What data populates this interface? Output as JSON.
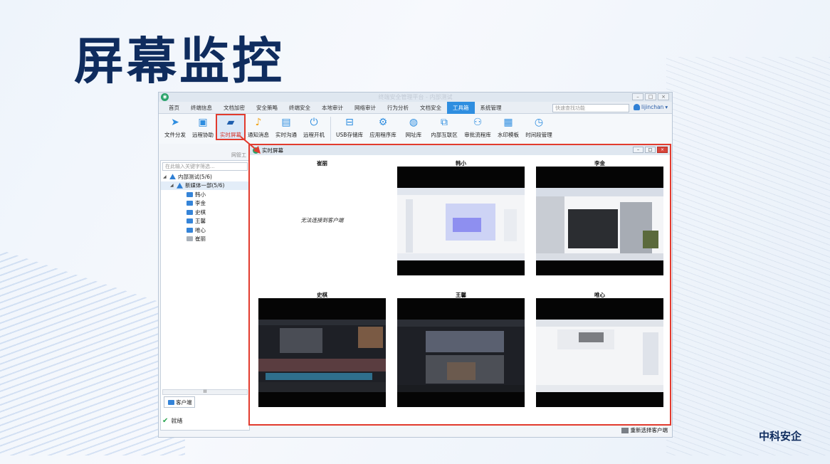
{
  "slide": {
    "title": "屏幕监控",
    "brand": "中科安企"
  },
  "app": {
    "window_title": "终端安全管理平台 - 内部测试",
    "menu": [
      "首页",
      "终端信息",
      "文档加密",
      "安全策略",
      "终端安全",
      "本地审计",
      "网络审计",
      "行为分析",
      "文档安全",
      "工具箱",
      "系统管理"
    ],
    "active_menu": "工具箱",
    "quick_search_placeholder": "快速查找功能",
    "user": "lijinchan",
    "toolbar": [
      {
        "label": "文件分发",
        "icon": "paper-plane-icon"
      },
      {
        "label": "远程协助",
        "icon": "remote-assist-icon"
      },
      {
        "label": "实时屏幕",
        "icon": "monitor-icon"
      },
      {
        "label": "通知消息",
        "icon": "bell-icon"
      },
      {
        "label": "实时沟通",
        "icon": "chat-icon"
      },
      {
        "label": "远程开机",
        "icon": "power-pc-icon"
      },
      {
        "label": "USB存储库",
        "icon": "usb-icon"
      },
      {
        "label": "应用程序库",
        "icon": "app-library-icon"
      },
      {
        "label": "网址库",
        "icon": "globe-icon"
      },
      {
        "label": "内部互联区",
        "icon": "network-icon"
      },
      {
        "label": "审批流程库",
        "icon": "approval-icon"
      },
      {
        "label": "水印模板",
        "icon": "watermark-icon"
      },
      {
        "label": "时间段管理",
        "icon": "clock-icon"
      }
    ],
    "group_label": "网管工",
    "sidebar": {
      "search_placeholder": "在此输入关键字筛选...",
      "tree": {
        "root": "内部测试(5/6)",
        "group": "新媒体一部(5/6)",
        "members": [
          {
            "name": "韩小",
            "online": true
          },
          {
            "name": "李金",
            "online": true
          },
          {
            "name": "史棋",
            "online": true
          },
          {
            "name": "王馨",
            "online": true
          },
          {
            "name": "唯心",
            "online": true
          },
          {
            "name": "崔丽",
            "online": false
          }
        ]
      },
      "tab": "客户端",
      "scroll_mark": "III",
      "status": "就绪"
    },
    "realtime": {
      "title": "实时屏幕",
      "tiles": [
        {
          "name": "崔丽",
          "offline_text": "无法连接到客户端"
        },
        {
          "name": "韩小"
        },
        {
          "name": "李金"
        },
        {
          "name": "史棋"
        },
        {
          "name": "王馨"
        },
        {
          "name": "唯心"
        }
      ],
      "reselect_button": "重新选择客户端"
    }
  },
  "colors": {
    "title": "#0f2c5e",
    "highlight": "#e23b2e",
    "accent": "#2f8ee0"
  }
}
